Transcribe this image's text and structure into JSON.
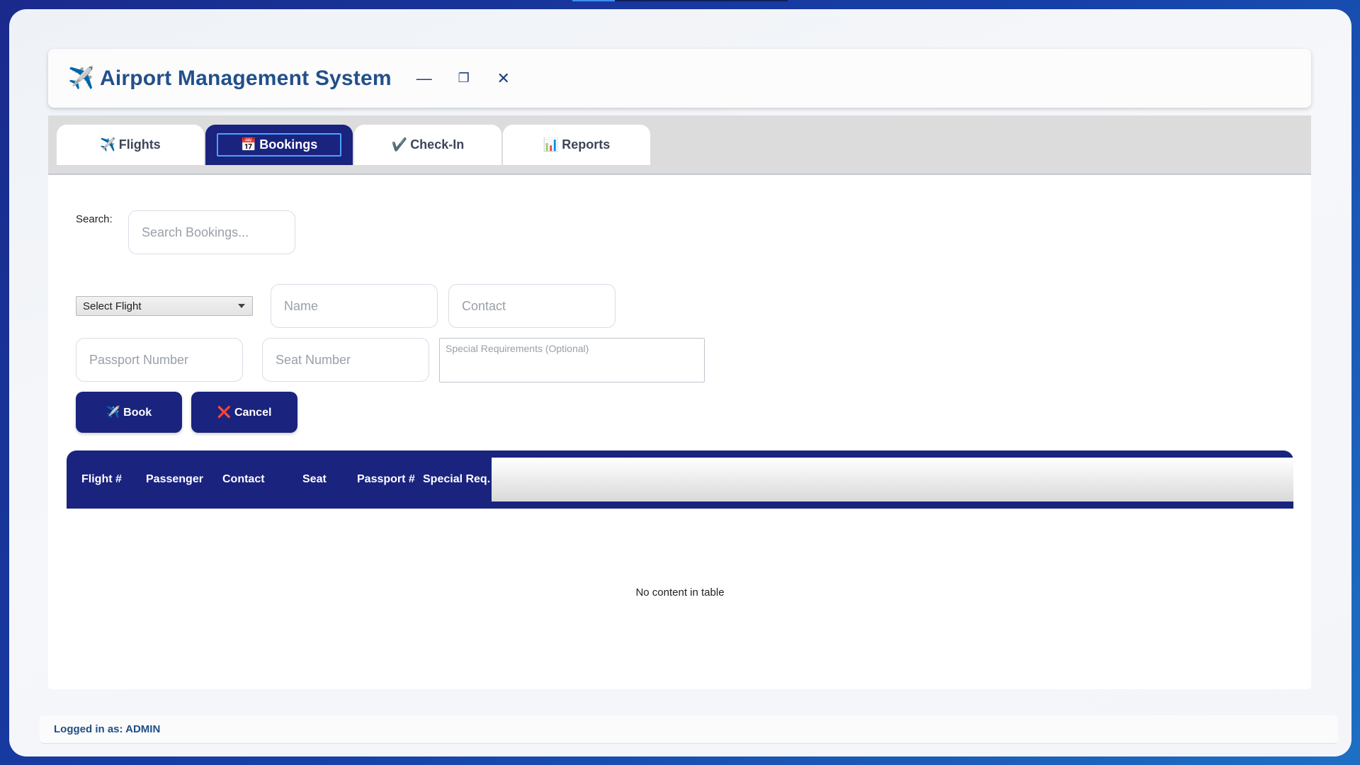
{
  "app": {
    "icon": "✈️",
    "title": "Airport Management System",
    "controls": {
      "minimize": "—",
      "maximize": "❐",
      "close": "✕"
    }
  },
  "tabs": [
    {
      "icon": "✈️",
      "label": "Flights",
      "active": false
    },
    {
      "icon": "📅",
      "label": "Bookings",
      "active": true
    },
    {
      "icon": "✔️",
      "label": "Check-In",
      "active": false
    },
    {
      "icon": "📊",
      "label": "Reports",
      "active": false
    }
  ],
  "search": {
    "label": "Search:",
    "placeholder": "Search Bookings..."
  },
  "form": {
    "flight_select": "Select Flight",
    "name_placeholder": "Name",
    "contact_placeholder": "Contact",
    "passport_placeholder": "Passport Number",
    "seat_placeholder": "Seat Number",
    "special_placeholder": "Special Requirements (Optional)"
  },
  "buttons": {
    "book": "✈️ Book",
    "cancel": "❌ Cancel"
  },
  "table": {
    "columns": [
      "Flight #",
      "Passenger",
      "Contact",
      "Seat",
      "Passport #",
      "Special Req."
    ],
    "rows": [],
    "empty_message": "No content in table"
  },
  "status": {
    "text": "Logged in as: ADMIN"
  },
  "colors": {
    "primary": "#1a237e",
    "title": "#22508a",
    "focus_outline": "#4aa3ff"
  }
}
